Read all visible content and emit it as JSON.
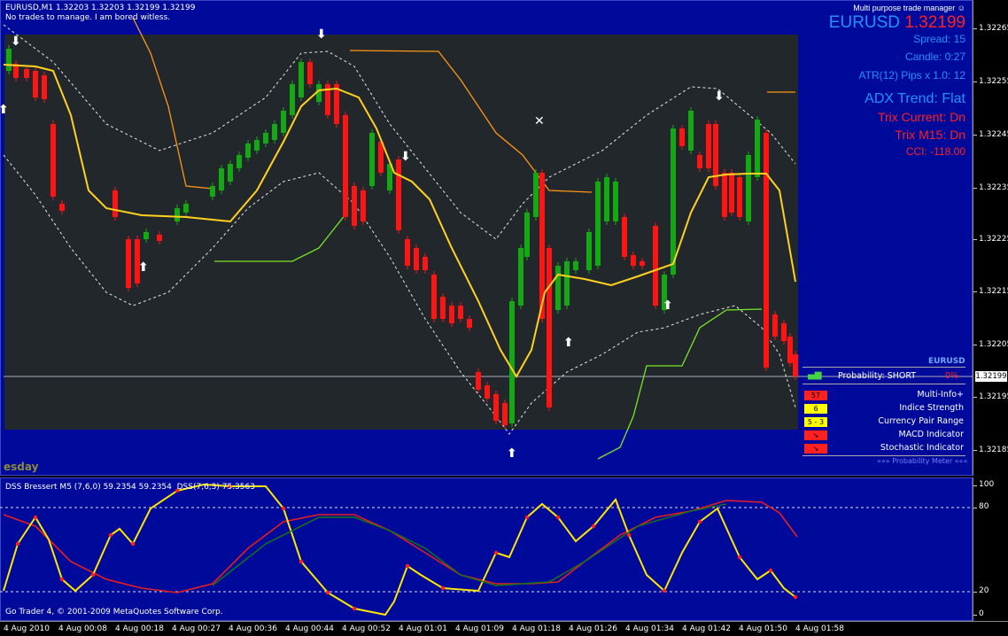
{
  "chart_header": {
    "symbol_line": "EURUSD,M1  1.32203 1.32203 1.32199 1.32199",
    "status_line": "No trades to manage. I am bored witless."
  },
  "trade_manager": {
    "title": "Multi purpose trade manager",
    "symbol": "EURUSD",
    "price": "1.32199",
    "spread": "Spread:  15",
    "candle": "Candle:  0:27",
    "atr": "ATR(12) Pips x 1.0:  12",
    "adx_trend": "ADX Trend: Flat",
    "trix_current": "Trix Current: Dn",
    "trix_m15": "Trix M15:  Dn",
    "cci": "CCI: -118.00"
  },
  "probability_meter": {
    "symbol": "EURUSD",
    "probability": "Probability:  SHORT",
    "percent": "0%",
    "footer": "»»» Probability Meter «««",
    "indicators": [
      {
        "badge": "57",
        "label": "Multi-Info+",
        "badge_color": "#ff2020",
        "text_color": "#000"
      },
      {
        "badge": "6",
        "label": "Indice Strength",
        "badge_color": "#ffff00",
        "text_color": "#000"
      },
      {
        "badge": "5 - 3",
        "label": "Currency Pair Range",
        "badge_color": "#ffff00",
        "text_color": "#000"
      },
      {
        "badge": "↘",
        "label": "MACD Indicator",
        "badge_color": "#ff2020",
        "text_color": "#000"
      },
      {
        "badge": "↘",
        "label": "Stochastic Indicator",
        "badge_color": "#ff2020",
        "text_color": "#000"
      }
    ]
  },
  "weekday_label": "esday",
  "price_axis": {
    "labels": [
      "1.32265",
      "1.32255",
      "1.32245",
      "1.32235",
      "1.32225",
      "1.32215",
      "1.32205",
      "1.32195",
      "1.32185"
    ],
    "current_price": "1.32199"
  },
  "sub_window": {
    "title": "DSS Bressert M5 (7,6,0) 59.2354 59.2354",
    "title2": "DSS(7,6,3) 75.3563",
    "axis_labels": [
      "100",
      "80",
      "20",
      "0"
    ],
    "copyright": "Go Trader 4, © 2001-2009 MetaQuotes Software Corp."
  },
  "time_axis": {
    "labels": [
      "4 Aug 2010",
      "4 Aug 00:08",
      "4 Aug 00:18",
      "4 Aug 00:27",
      "4 Aug 00:36",
      "4 Aug 00:44",
      "4 Aug 00:52",
      "4 Aug 01:01",
      "4 Aug 01:09",
      "4 Aug 01:18",
      "4 Aug 01:26",
      "4 Aug 01:34",
      "4 Aug 01:42",
      "4 Aug 01:50",
      "4 Aug 01:58"
    ]
  },
  "colors": {
    "background": "#000a9a",
    "plot_area": "#22272b",
    "bull_candle": "#14a814",
    "bear_candle": "#ff1414",
    "moving_average": "#ffd21e",
    "resistance": "#ff9614",
    "support": "#78e628",
    "dss_slow": "#e61e1e",
    "dss_signal": "#147814",
    "dss_fast": "#ffe600"
  }
}
